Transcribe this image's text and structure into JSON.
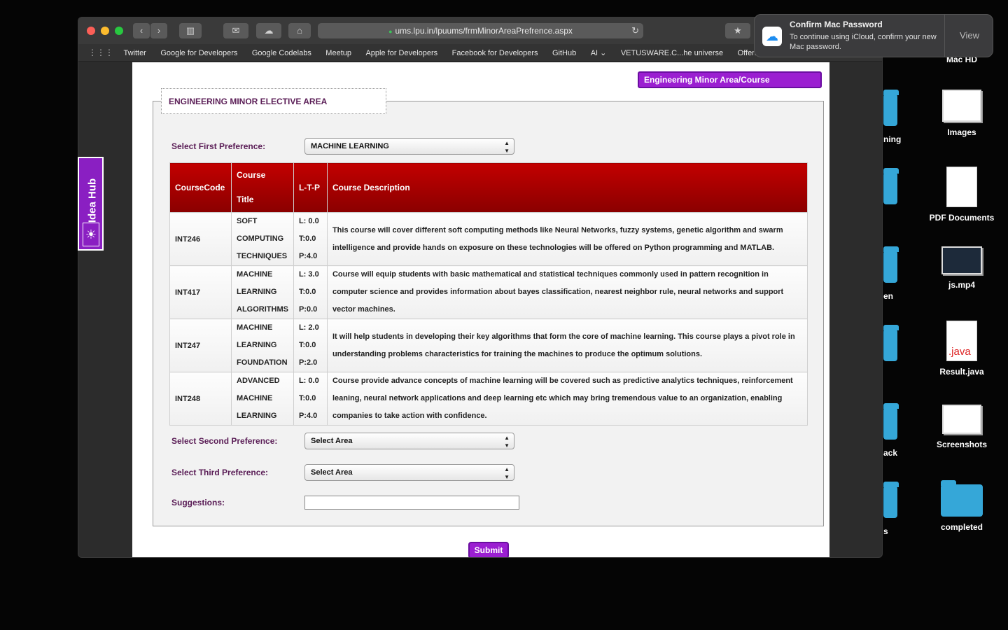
{
  "browser": {
    "url": "ums.lpu.in/lpuums/frmMinorAreaPrefrence.aspx",
    "bookmarks": [
      "Twitter",
      "Google for Developers",
      "Google Codelabs",
      "Meetup",
      "Apple for Developers",
      "Facebook for Developers",
      "GitHub",
      "AI",
      "VETUSWARE.C...he universe",
      "Offensive"
    ]
  },
  "page": {
    "top_button": "Engineering Minor Area/Course Description",
    "legend": "ENGINEERING MINOR ELECTIVE AREA",
    "first_pref_label": "Select First Preference:",
    "first_pref_value": "MACHINE LEARNING",
    "second_pref_label": "Select Second Preference:",
    "second_pref_value": "Select Area",
    "third_pref_label": "Select Third Preference:",
    "third_pref_value": "Select Area",
    "suggestions_label": "Suggestions:",
    "submit": "Submit"
  },
  "table": {
    "headers": {
      "code": "CourseCode",
      "title_1": "Course",
      "title_2": "Title",
      "ltp": "L-T-P",
      "desc": "Course Description"
    },
    "rows": [
      {
        "code": "INT246",
        "title": [
          "SOFT",
          "COMPUTING",
          "TECHNIQUES"
        ],
        "ltp": [
          "L: 0.0",
          "T:0.0",
          "P:4.0"
        ],
        "desc": "This course will cover different soft computing methods like Neural Networks, fuzzy systems, genetic algorithm and swarm intelligence and provide hands on exposure on these technologies will be offered on Python programming and MATLAB."
      },
      {
        "code": "INT417",
        "title": [
          "MACHINE",
          "LEARNING",
          "ALGORITHMS"
        ],
        "ltp": [
          "L: 3.0",
          "T:0.0",
          "P:0.0"
        ],
        "desc": "Course will equip students with basic mathematical and statistical techniques commonly used in pattern recognition in computer science and provides information about bayes classification, nearest neighbor rule, neural networks and support vector machines."
      },
      {
        "code": "INT247",
        "title": [
          "MACHINE",
          "LEARNING",
          "FOUNDATION"
        ],
        "ltp": [
          "L: 2.0",
          "T:0.0",
          "P:2.0"
        ],
        "desc": "It will help students in developing their key algorithms that form the core of machine learning. This course plays a pivot role in understanding problems characteristics for training the machines to produce the optimum solutions."
      },
      {
        "code": "INT248",
        "title": [
          "ADVANCED",
          "MACHINE",
          "LEARNING"
        ],
        "ltp": [
          "L: 0.0",
          "T:0.0",
          "P:4.0"
        ],
        "desc": "Course provide advance concepts of machine learning will be covered such as predictive analytics techniques, reinforcement leaning, neural network applications and deep learning etc which may bring tremendous value to an organization, enabling companies to take action with confidence."
      }
    ]
  },
  "ideahub": {
    "label": "Idea Hub"
  },
  "notification": {
    "title": "Confirm Mac Password",
    "body": "To continue using iCloud, confirm your new Mac password.",
    "action": "View"
  },
  "desktop": {
    "items": [
      "Mac HD",
      "Images",
      "PDF Documents",
      "js.mp4",
      "Result.java",
      "Screenshots",
      "completed"
    ],
    "partial_labels": [
      "ning",
      "en",
      "ack",
      "s"
    ],
    "java_badge": ".java"
  }
}
